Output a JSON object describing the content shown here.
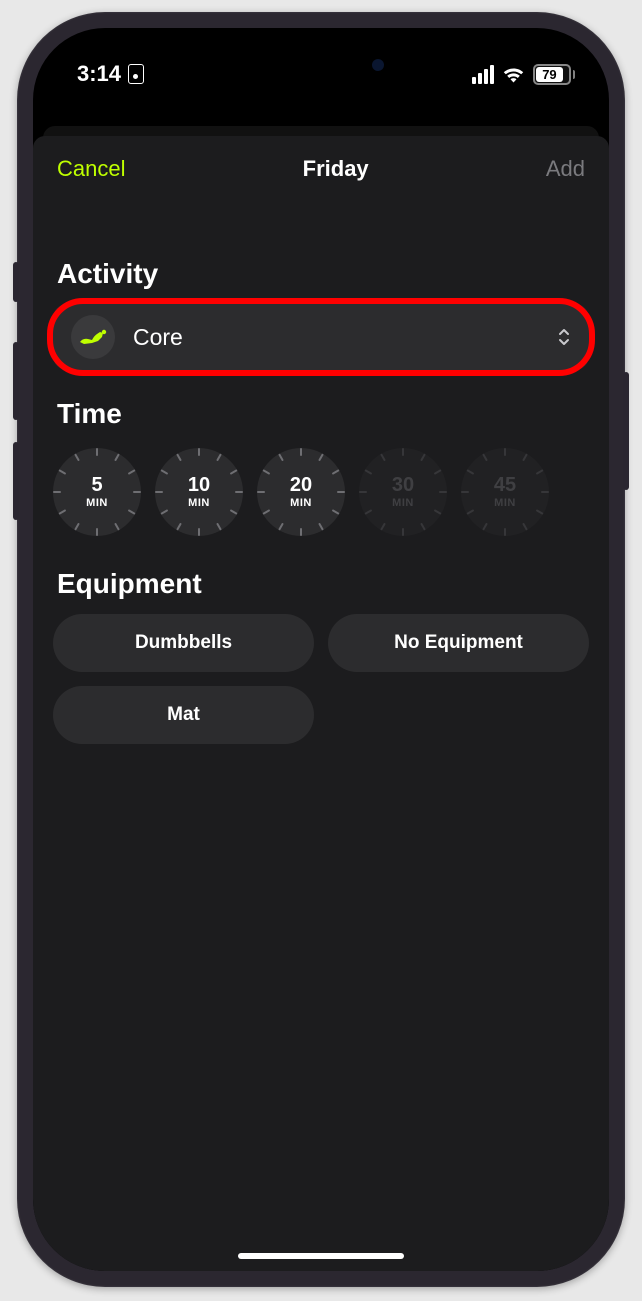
{
  "status": {
    "time": "3:14",
    "battery_percent": "79"
  },
  "nav": {
    "cancel": "Cancel",
    "title": "Friday",
    "add": "Add"
  },
  "sections": {
    "activity_title": "Activity",
    "time_title": "Time",
    "equipment_title": "Equipment"
  },
  "activity": {
    "selected": "Core"
  },
  "time_options": [
    {
      "value": "5",
      "unit": "MIN",
      "enabled": true
    },
    {
      "value": "10",
      "unit": "MIN",
      "enabled": true
    },
    {
      "value": "20",
      "unit": "MIN",
      "enabled": true
    },
    {
      "value": "30",
      "unit": "MIN",
      "enabled": false
    },
    {
      "value": "45",
      "unit": "MIN",
      "enabled": false
    }
  ],
  "equipment_options": [
    {
      "label": "Dumbbells"
    },
    {
      "label": "No Equipment"
    },
    {
      "label": "Mat"
    }
  ],
  "colors": {
    "accent": "#bfff00",
    "highlight": "#ff0000"
  }
}
